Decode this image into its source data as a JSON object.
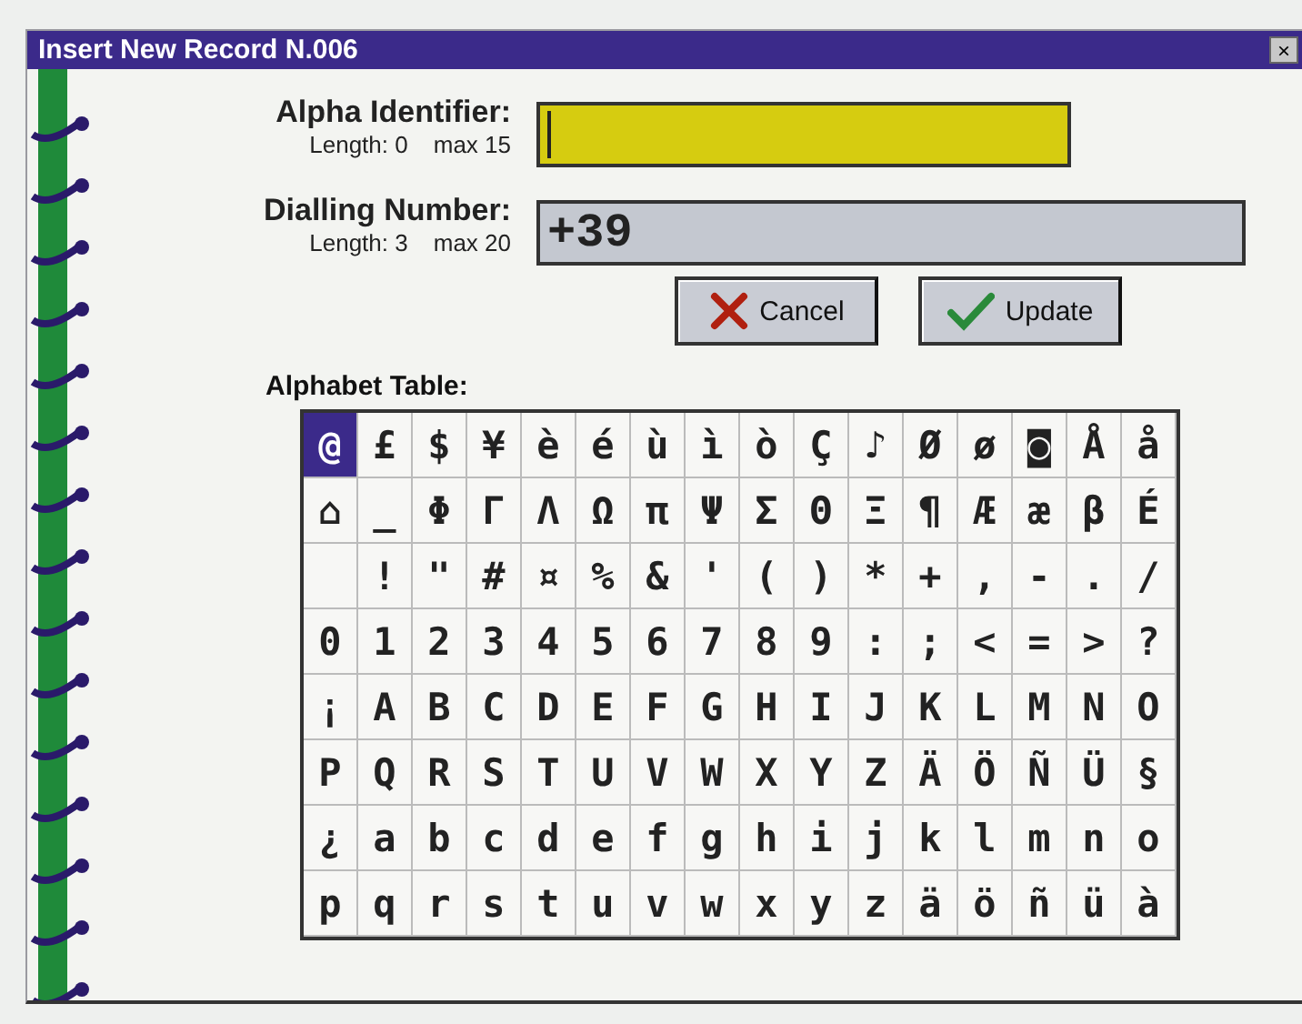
{
  "window": {
    "title": "Insert New Record N.006",
    "close": "×"
  },
  "fields": [
    {
      "label": "Alpha Identifier:",
      "length": "Length: 0",
      "max": "max 15",
      "focused": true
    },
    {
      "label": "Dialling Number:",
      "length": "Length: 3",
      "max": "max 20",
      "value": "+39",
      "focused": false
    }
  ],
  "buttons": [
    {
      "label": "Cancel",
      "kind": "cancel"
    },
    {
      "label": "Update",
      "kind": "update"
    }
  ],
  "alphabet_table": {
    "title": "Alphabet Table:",
    "rows": [
      [
        {
          "c": "@",
          "selected": true
        },
        {
          "c": "£",
          "selected": false
        },
        {
          "c": "$",
          "selected": false
        },
        {
          "c": "¥",
          "selected": false
        },
        {
          "c": "è",
          "selected": false
        },
        {
          "c": "é",
          "selected": false
        },
        {
          "c": "ù",
          "selected": false
        },
        {
          "c": "ì",
          "selected": false
        },
        {
          "c": "ò",
          "selected": false
        },
        {
          "c": "Ç",
          "selected": false
        },
        {
          "c": "♪",
          "selected": false
        },
        {
          "c": "Ø",
          "selected": false
        },
        {
          "c": "ø",
          "selected": false
        },
        {
          "c": "◙",
          "selected": false
        },
        {
          "c": "Å",
          "selected": false
        },
        {
          "c": "å",
          "selected": false
        }
      ],
      [
        {
          "c": "⌂",
          "selected": false
        },
        {
          "c": "_",
          "selected": false
        },
        {
          "c": "Φ",
          "selected": false
        },
        {
          "c": "Γ",
          "selected": false
        },
        {
          "c": "Λ",
          "selected": false
        },
        {
          "c": "Ω",
          "selected": false
        },
        {
          "c": "π",
          "selected": false
        },
        {
          "c": "Ψ",
          "selected": false
        },
        {
          "c": "Σ",
          "selected": false
        },
        {
          "c": "Θ",
          "selected": false
        },
        {
          "c": "Ξ",
          "selected": false
        },
        {
          "c": "¶",
          "selected": false
        },
        {
          "c": "Æ",
          "selected": false
        },
        {
          "c": "æ",
          "selected": false
        },
        {
          "c": "β",
          "selected": false
        },
        {
          "c": "É",
          "selected": false
        }
      ],
      [
        {
          "selected": false
        },
        {
          "c": "!",
          "selected": false
        },
        {
          "c": "\"",
          "selected": false
        },
        {
          "c": "#",
          "selected": false
        },
        {
          "c": "¤",
          "selected": false
        },
        {
          "c": "%",
          "selected": false
        },
        {
          "c": "&",
          "selected": false
        },
        {
          "c": "'",
          "selected": false
        },
        {
          "c": "(",
          "selected": false
        },
        {
          "c": ")",
          "selected": false
        },
        {
          "c": "*",
          "selected": false
        },
        {
          "c": "+",
          "selected": false
        },
        {
          "c": ",",
          "selected": false
        },
        {
          "c": "-",
          "selected": false
        },
        {
          "c": ".",
          "selected": false
        },
        {
          "c": "/",
          "selected": false
        }
      ],
      [
        {
          "c": "0",
          "selected": false
        },
        {
          "c": "1",
          "selected": false
        },
        {
          "c": "2",
          "selected": false
        },
        {
          "c": "3",
          "selected": false
        },
        {
          "c": "4",
          "selected": false
        },
        {
          "c": "5",
          "selected": false
        },
        {
          "c": "6",
          "selected": false
        },
        {
          "c": "7",
          "selected": false
        },
        {
          "c": "8",
          "selected": false
        },
        {
          "c": "9",
          "selected": false
        },
        {
          "c": ":",
          "selected": false
        },
        {
          "c": ";",
          "selected": false
        },
        {
          "c": "<",
          "selected": false
        },
        {
          "c": "=",
          "selected": false
        },
        {
          "c": ">",
          "selected": false
        },
        {
          "c": "?",
          "selected": false
        }
      ],
      [
        {
          "c": "¡",
          "selected": false
        },
        {
          "c": "A",
          "selected": false
        },
        {
          "c": "B",
          "selected": false
        },
        {
          "c": "C",
          "selected": false
        },
        {
          "c": "D",
          "selected": false
        },
        {
          "c": "E",
          "selected": false
        },
        {
          "c": "F",
          "selected": false
        },
        {
          "c": "G",
          "selected": false
        },
        {
          "c": "H",
          "selected": false
        },
        {
          "c": "I",
          "selected": false
        },
        {
          "c": "J",
          "selected": false
        },
        {
          "c": "K",
          "selected": false
        },
        {
          "c": "L",
          "selected": false
        },
        {
          "c": "M",
          "selected": false
        },
        {
          "c": "N",
          "selected": false
        },
        {
          "c": "O",
          "selected": false
        }
      ],
      [
        {
          "c": "P",
          "selected": false
        },
        {
          "c": "Q",
          "selected": false
        },
        {
          "c": "R",
          "selected": false
        },
        {
          "c": "S",
          "selected": false
        },
        {
          "c": "T",
          "selected": false
        },
        {
          "c": "U",
          "selected": false
        },
        {
          "c": "V",
          "selected": false
        },
        {
          "c": "W",
          "selected": false
        },
        {
          "c": "X",
          "selected": false
        },
        {
          "c": "Y",
          "selected": false
        },
        {
          "c": "Z",
          "selected": false
        },
        {
          "c": "Ä",
          "selected": false
        },
        {
          "c": "Ö",
          "selected": false
        },
        {
          "c": "Ñ",
          "selected": false
        },
        {
          "c": "Ü",
          "selected": false
        },
        {
          "c": "§",
          "selected": false
        }
      ],
      [
        {
          "c": "¿",
          "selected": false
        },
        {
          "c": "a",
          "selected": false
        },
        {
          "c": "b",
          "selected": false
        },
        {
          "c": "c",
          "selected": false
        },
        {
          "c": "d",
          "selected": false
        },
        {
          "c": "e",
          "selected": false
        },
        {
          "c": "f",
          "selected": false
        },
        {
          "c": "g",
          "selected": false
        },
        {
          "c": "h",
          "selected": false
        },
        {
          "c": "i",
          "selected": false
        },
        {
          "c": "j",
          "selected": false
        },
        {
          "c": "k",
          "selected": false
        },
        {
          "c": "l",
          "selected": false
        },
        {
          "c": "m",
          "selected": false
        },
        {
          "c": "n",
          "selected": false
        },
        {
          "c": "o",
          "selected": false
        }
      ],
      [
        {
          "c": "p",
          "selected": false
        },
        {
          "c": "q",
          "selected": false
        },
        {
          "c": "r",
          "selected": false
        },
        {
          "c": "s",
          "selected": false
        },
        {
          "c": "t",
          "selected": false
        },
        {
          "c": "u",
          "selected": false
        },
        {
          "c": "v",
          "selected": false
        },
        {
          "c": "w",
          "selected": false
        },
        {
          "c": "x",
          "selected": false
        },
        {
          "c": "y",
          "selected": false
        },
        {
          "c": "z",
          "selected": false
        },
        {
          "c": "ä",
          "selected": false
        },
        {
          "c": "ö",
          "selected": false
        },
        {
          "c": "ñ",
          "selected": false
        },
        {
          "c": "ü",
          "selected": false
        },
        {
          "c": "à",
          "selected": false
        }
      ]
    ]
  }
}
